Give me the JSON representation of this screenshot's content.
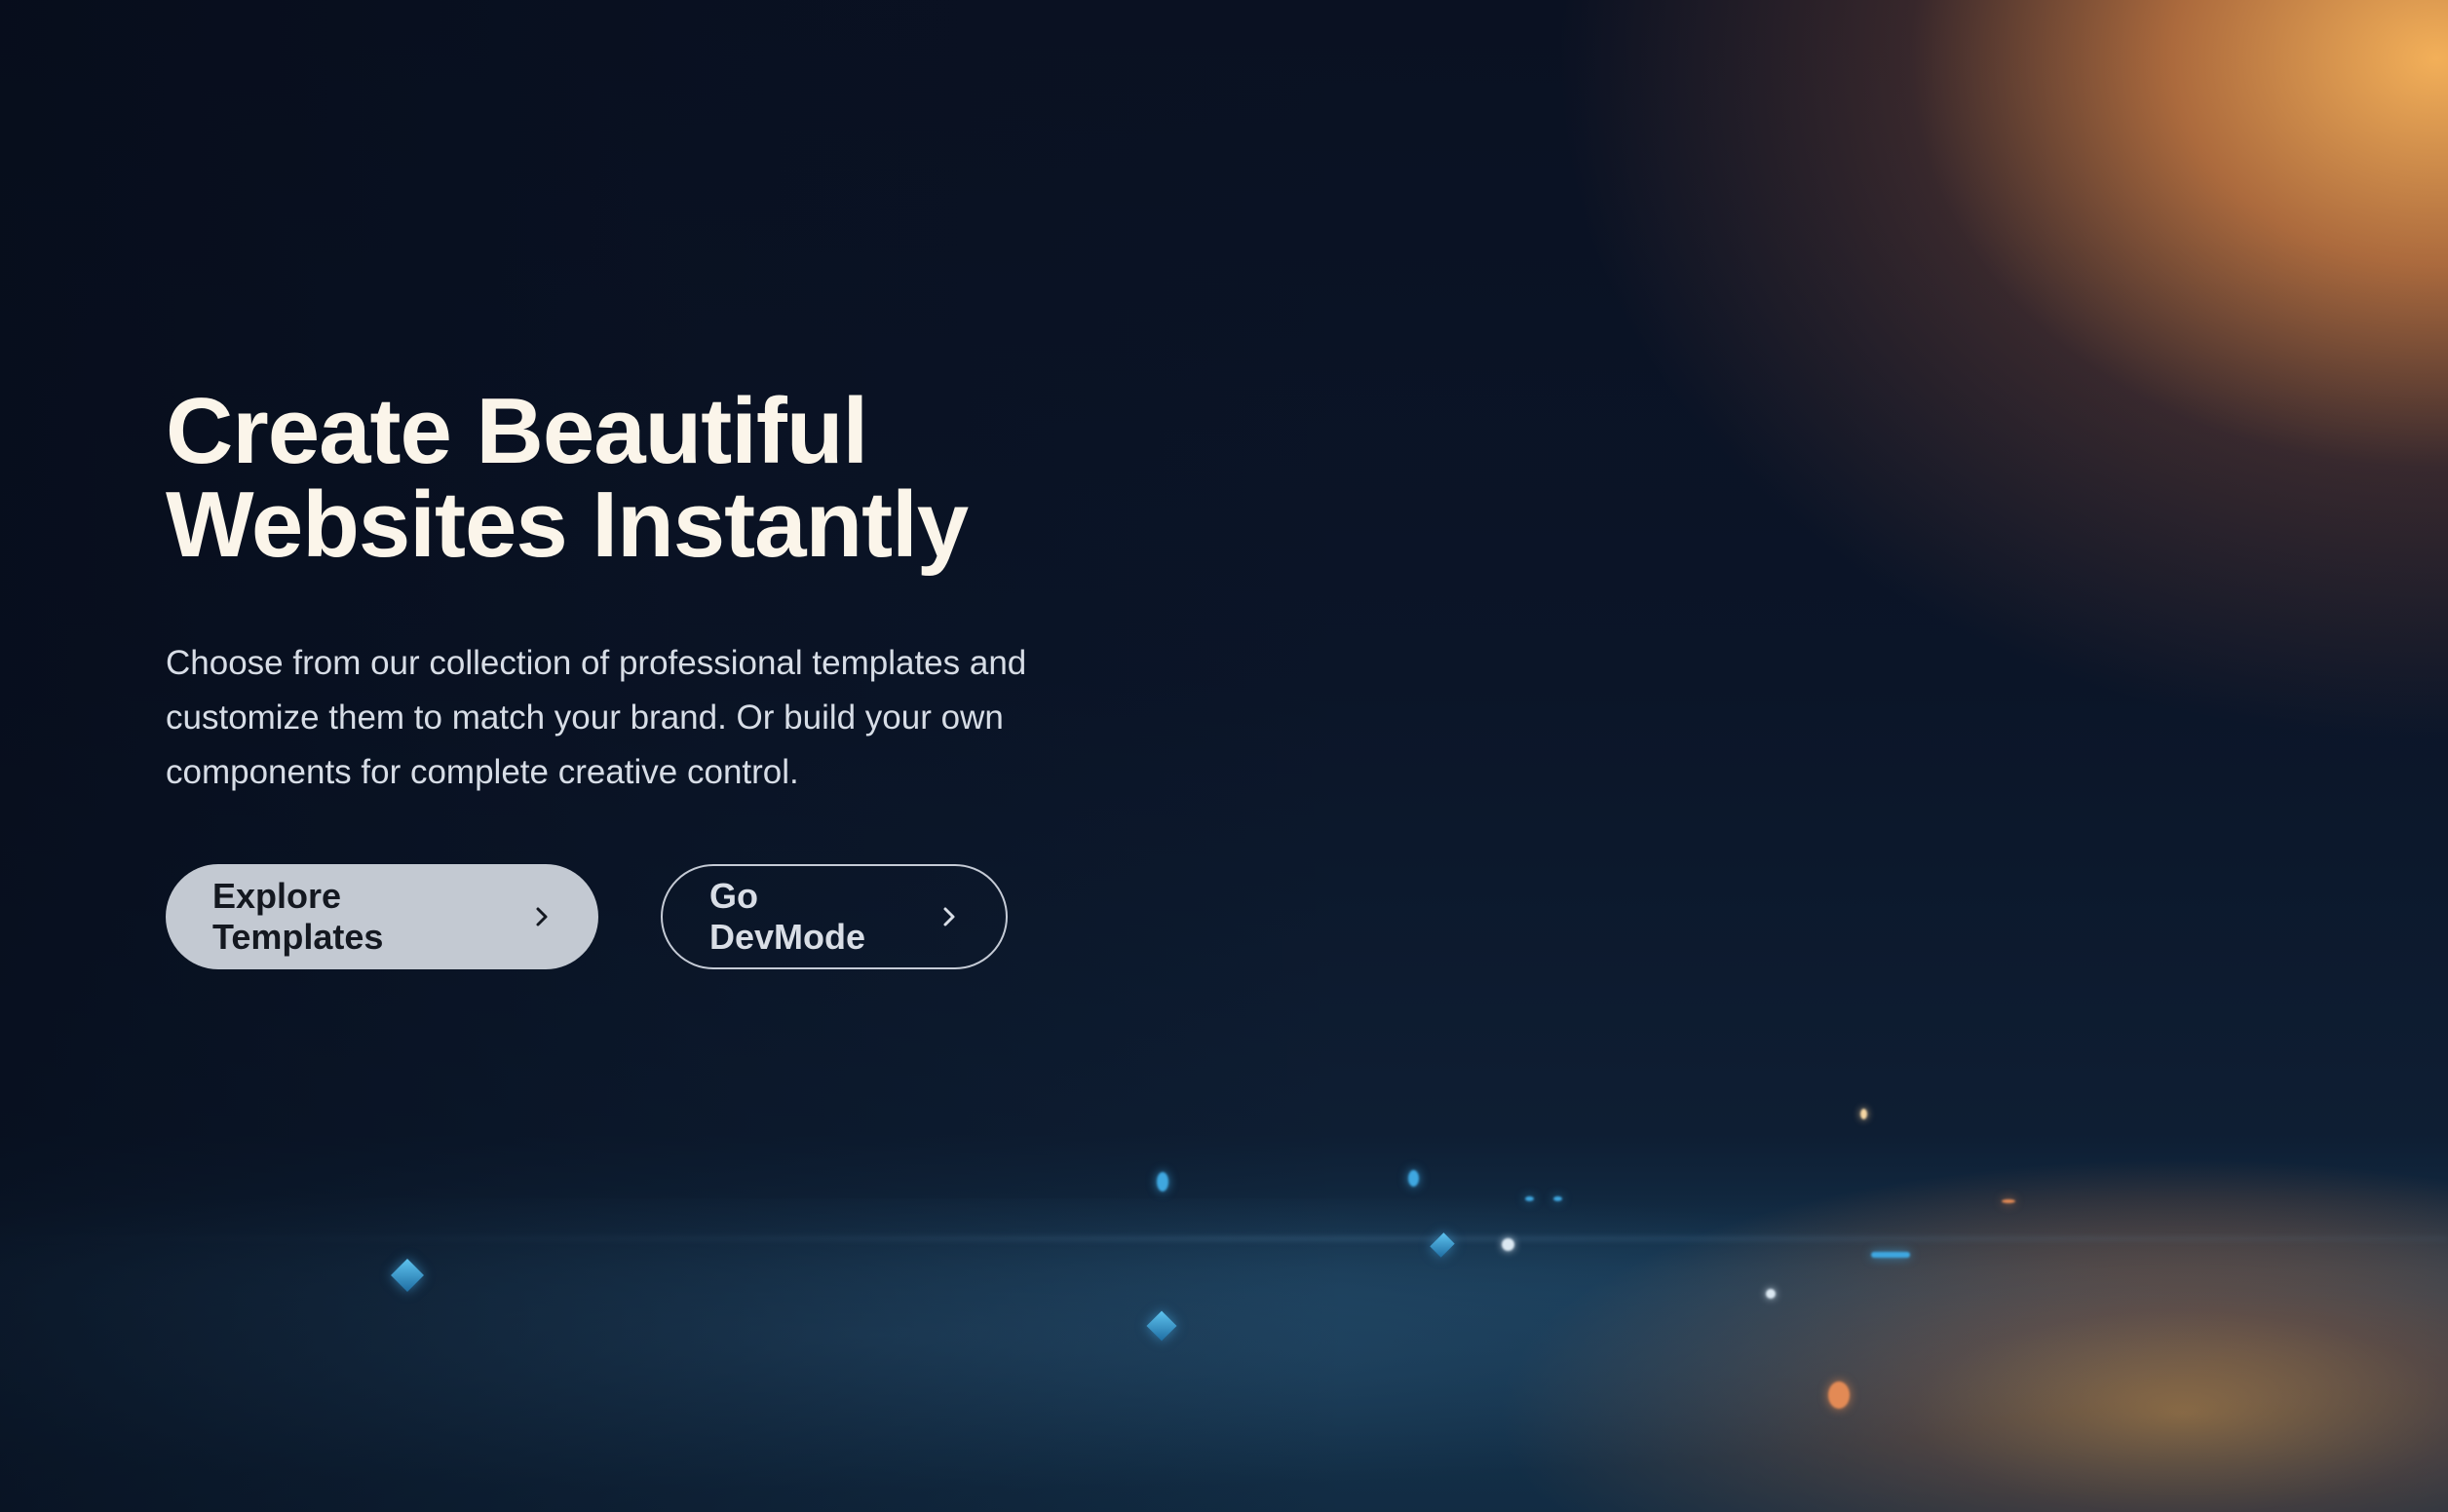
{
  "hero": {
    "title_line1": "Create Beautiful",
    "title_line2": "Websites Instantly",
    "subtitle_line1": "Choose from our collection of professional templates and",
    "subtitle_line2": "customize them to match your brand. Or build your own",
    "subtitle_line3": "components for complete creative control."
  },
  "buttons": {
    "primary_label": "Explore Templates",
    "secondary_label": "Go DevMode"
  },
  "icons": {
    "primary_arrow": "chevron-right-icon",
    "secondary_arrow": "chevron-right-icon"
  },
  "colors": {
    "title": "#fbf5ea",
    "subtitle": "#d7dde6",
    "primary_button_bg": "#c3c9d2",
    "primary_button_text": "#141820",
    "secondary_button_border": "#e6ebf5",
    "background_dark": "#0a1326",
    "accent_glow": "#ffb85c"
  }
}
